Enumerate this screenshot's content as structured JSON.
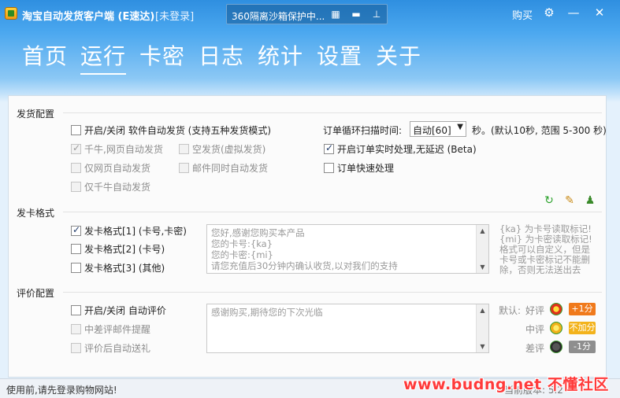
{
  "titlebar": {
    "app_title": "淘宝自动发货客户端 (E速达)",
    "login_status": "[未登录]",
    "ticker_text": "360隔离沙箱保护中...",
    "buy_label": "购买"
  },
  "nav": {
    "items": [
      "首页",
      "运行",
      "卡密",
      "日志",
      "统计",
      "设置",
      "关于"
    ],
    "active": "运行"
  },
  "delivery": {
    "title": "发货配置",
    "master_toggle": "开启/关闭 软件自动发货 (支持五种发货模式)",
    "qianniu_web": "千牛,网页自动发货",
    "empty_ship": "空发货(虚拟发货)",
    "web_only": "仅网页自动发货",
    "email_sync": "邮件同时自动发货",
    "qianniu_only": "仅千牛自动发货",
    "scan_label": "订单循环扫描时间:",
    "scan_value": "自动[60]",
    "scan_suffix": "秒。(默认10秒, 范围 5-300 秒)",
    "realtime": "开启订单实时处理,无延迟 (Beta)",
    "fast": "订单快速处理"
  },
  "card_format": {
    "title": "发卡格式",
    "format1": "发卡格式[1] (卡号,卡密)",
    "format2": "发卡格式[2] (卡号)",
    "format3": "发卡格式[3] (其他)",
    "template_lines": [
      "您好,感谢您购买本产品",
      "您的卡号:{ka}",
      "您的卡密:{mi}",
      "请您充值后30分钟内确认收货,以对我们的支持"
    ],
    "hint_lines": [
      "{ka} 为卡号读取标记!",
      "{mi} 为卡密读取标记!",
      "格式可以自定义，但是",
      "卡号或卡密标记不能删",
      "除，否则无法送出去"
    ]
  },
  "review": {
    "title": "评价配置",
    "auto_review": "开启/关闭 自动评价",
    "negative_email": "中差评邮件提醒",
    "review_gift": "评价后自动送礼",
    "review_text": "感谢购买,期待您的下次光临",
    "default_label": "默认:",
    "good_label": "好评",
    "mid_label": "中评",
    "bad_label": "差评",
    "good_badge": "+1分",
    "mid_badge": "不加分",
    "bad_badge": "-1分"
  },
  "statusbar": {
    "text": "使用前,请先登录购物网站!",
    "version": "当前版本: 5.2"
  },
  "watermark": "www.budng.net 不懂社区",
  "colors": {
    "accent_blue": "#2f8fe0",
    "good_badge": "#f07a1c",
    "mid_badge": "#f3b31c",
    "bad_badge": "#8e8e8e"
  }
}
